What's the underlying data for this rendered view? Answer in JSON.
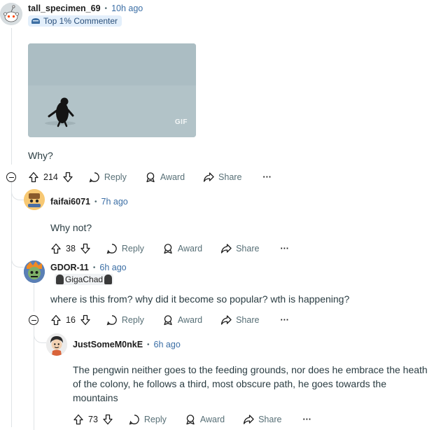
{
  "comments": [
    {
      "username": "tall_specimen_69",
      "time": "10h ago",
      "badge": "Top 1% Commenter",
      "media_label": "GIF",
      "text": "Why?",
      "score": "214",
      "reply_label": "Reply",
      "award_label": "Award",
      "share_label": "Share",
      "more_label": "···"
    },
    {
      "username": "faifai6071",
      "time": "7h ago",
      "text": "Why not?",
      "score": "38",
      "reply_label": "Reply",
      "award_label": "Award",
      "share_label": "Share",
      "more_label": "···"
    },
    {
      "username": "GDOR-11",
      "time": "6h ago",
      "flair": "GigaChad",
      "text": "where is this from? why did it become so popular? wth is happening?",
      "score": "16",
      "reply_label": "Reply",
      "award_label": "Award",
      "share_label": "Share",
      "more_label": "···"
    },
    {
      "username": "JustSomeM0nkE",
      "time": "6h ago",
      "text": "The pengwin neither goes to the feeding grounds, nor does he embrace the heath of the colony, he follows a third, most obscure path, he goes towards the mountains",
      "score": "73",
      "reply_label": "Reply",
      "award_label": "Award",
      "share_label": "Share",
      "more_label": "···"
    }
  ],
  "dot": "•"
}
